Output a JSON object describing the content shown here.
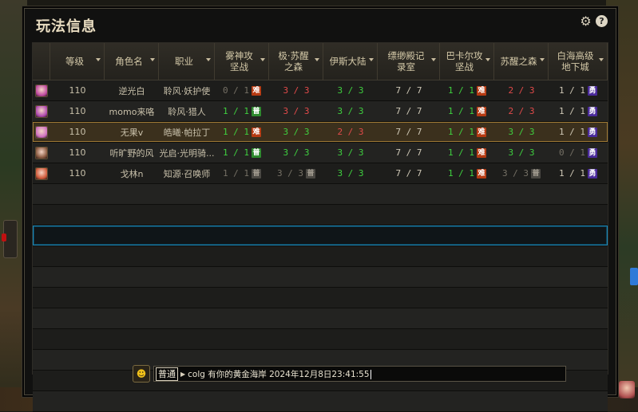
{
  "window": {
    "title": "玩法信息",
    "settings_icon": "gear-icon",
    "help_icon": "help-icon",
    "help_glyph": "?"
  },
  "columns": [
    {
      "key": "avatar",
      "label": ""
    },
    {
      "key": "level",
      "label": "等级"
    },
    {
      "key": "name",
      "label": "角色名"
    },
    {
      "key": "job",
      "label": "职业"
    },
    {
      "key": "c1",
      "label": "雾神攻坚战"
    },
    {
      "key": "c2",
      "label": "极·苏醒之森"
    },
    {
      "key": "c3",
      "label": "伊斯大陆"
    },
    {
      "key": "c4",
      "label": "缥缈殿记录室"
    },
    {
      "key": "c5",
      "label": "巴卡尔攻坚战"
    },
    {
      "key": "c6",
      "label": "苏醒之森"
    },
    {
      "key": "c7",
      "label": "白海高级地下城"
    }
  ],
  "rows": [
    {
      "avatar_color": "#c04aa0",
      "level": "110",
      "name": "逆光白",
      "job": "聆风·妖护使",
      "selected": false,
      "cells": [
        {
          "text": "0 / 1",
          "color": "gray",
          "tag": "难",
          "tag_type": "hard"
        },
        {
          "text": "3 / 3",
          "color": "red",
          "tag": "",
          "tag_type": ""
        },
        {
          "text": "3 / 3",
          "color": "green",
          "tag": "",
          "tag_type": ""
        },
        {
          "text": "7 / 7",
          "color": "white",
          "tag": "",
          "tag_type": ""
        },
        {
          "text": "1 / 1",
          "color": "green",
          "tag": "难",
          "tag_type": "hard"
        },
        {
          "text": "2 / 3",
          "color": "red",
          "tag": "",
          "tag_type": ""
        },
        {
          "text": "1 / 1",
          "color": "white",
          "tag": "勇",
          "tag_type": "hero"
        }
      ]
    },
    {
      "avatar_color": "#b04ab0",
      "level": "110",
      "name": "momo来咯",
      "job": "聆风·猎人",
      "selected": false,
      "cells": [
        {
          "text": "1 / 1",
          "color": "green",
          "tag": "普",
          "tag_type": "norm"
        },
        {
          "text": "3 / 3",
          "color": "red",
          "tag": "",
          "tag_type": ""
        },
        {
          "text": "3 / 3",
          "color": "green",
          "tag": "",
          "tag_type": ""
        },
        {
          "text": "7 / 7",
          "color": "white",
          "tag": "",
          "tag_type": ""
        },
        {
          "text": "1 / 1",
          "color": "green",
          "tag": "难",
          "tag_type": "hard"
        },
        {
          "text": "2 / 3",
          "color": "red",
          "tag": "",
          "tag_type": ""
        },
        {
          "text": "1 / 1",
          "color": "white",
          "tag": "勇",
          "tag_type": "hero"
        }
      ]
    },
    {
      "avatar_color": "#d070c0",
      "level": "110",
      "name": "无果v",
      "job": "皓曦·帕拉丁",
      "selected": true,
      "cells": [
        {
          "text": "1 / 1",
          "color": "green",
          "tag": "难",
          "tag_type": "hard"
        },
        {
          "text": "3 / 3",
          "color": "green",
          "tag": "",
          "tag_type": ""
        },
        {
          "text": "2 / 3",
          "color": "red",
          "tag": "",
          "tag_type": ""
        },
        {
          "text": "7 / 7",
          "color": "white",
          "tag": "",
          "tag_type": ""
        },
        {
          "text": "1 / 1",
          "color": "green",
          "tag": "难",
          "tag_type": "hard"
        },
        {
          "text": "3 / 3",
          "color": "green",
          "tag": "",
          "tag_type": ""
        },
        {
          "text": "1 / 1",
          "color": "white",
          "tag": "勇",
          "tag_type": "hero"
        }
      ]
    },
    {
      "avatar_color": "#8a5a40",
      "level": "110",
      "name": "听旷野的风",
      "job": "光启·光明骑...",
      "selected": false,
      "cells": [
        {
          "text": "1 / 1",
          "color": "green",
          "tag": "普",
          "tag_type": "norm"
        },
        {
          "text": "3 / 3",
          "color": "green",
          "tag": "",
          "tag_type": ""
        },
        {
          "text": "3 / 3",
          "color": "green",
          "tag": "",
          "tag_type": ""
        },
        {
          "text": "7 / 7",
          "color": "white",
          "tag": "",
          "tag_type": ""
        },
        {
          "text": "1 / 1",
          "color": "green",
          "tag": "难",
          "tag_type": "hard"
        },
        {
          "text": "3 / 3",
          "color": "green",
          "tag": "",
          "tag_type": ""
        },
        {
          "text": "0 / 1",
          "color": "gray",
          "tag": "勇",
          "tag_type": "hero"
        }
      ]
    },
    {
      "avatar_color": "#d05a3a",
      "level": "110",
      "name": "戈林n",
      "job": "知源·召唤师",
      "selected": false,
      "cells": [
        {
          "text": "1 / 1",
          "color": "gray",
          "tag": "普",
          "tag_type": "grey"
        },
        {
          "text": "3 / 3",
          "color": "gray",
          "tag": "普",
          "tag_type": "grey"
        },
        {
          "text": "3 / 3",
          "color": "green",
          "tag": "",
          "tag_type": ""
        },
        {
          "text": "7 / 7",
          "color": "white",
          "tag": "",
          "tag_type": ""
        },
        {
          "text": "1 / 1",
          "color": "green",
          "tag": "难",
          "tag_type": "hard"
        },
        {
          "text": "3 / 3",
          "color": "gray",
          "tag": "普",
          "tag_type": "grey"
        },
        {
          "text": "1 / 1",
          "color": "white",
          "tag": "勇",
          "tag_type": "hero"
        }
      ]
    }
  ],
  "empty_rows": 11,
  "cursor_row_index": 7,
  "chat": {
    "emoji_icon": "smiley-icon",
    "channel": "普通",
    "channel_arrow": "▶",
    "message": "colg 有你的黄金海岸 2024年12月8日23:41:55"
  },
  "colors": {
    "selected_row": "#3b301d",
    "cursor_border": "#1e88b8",
    "green": "#3fd03f",
    "red": "#e24a4a",
    "tag_hard": "#b63a12",
    "tag_normal": "#2e8a2e",
    "tag_hero": "#4a2a9a"
  }
}
